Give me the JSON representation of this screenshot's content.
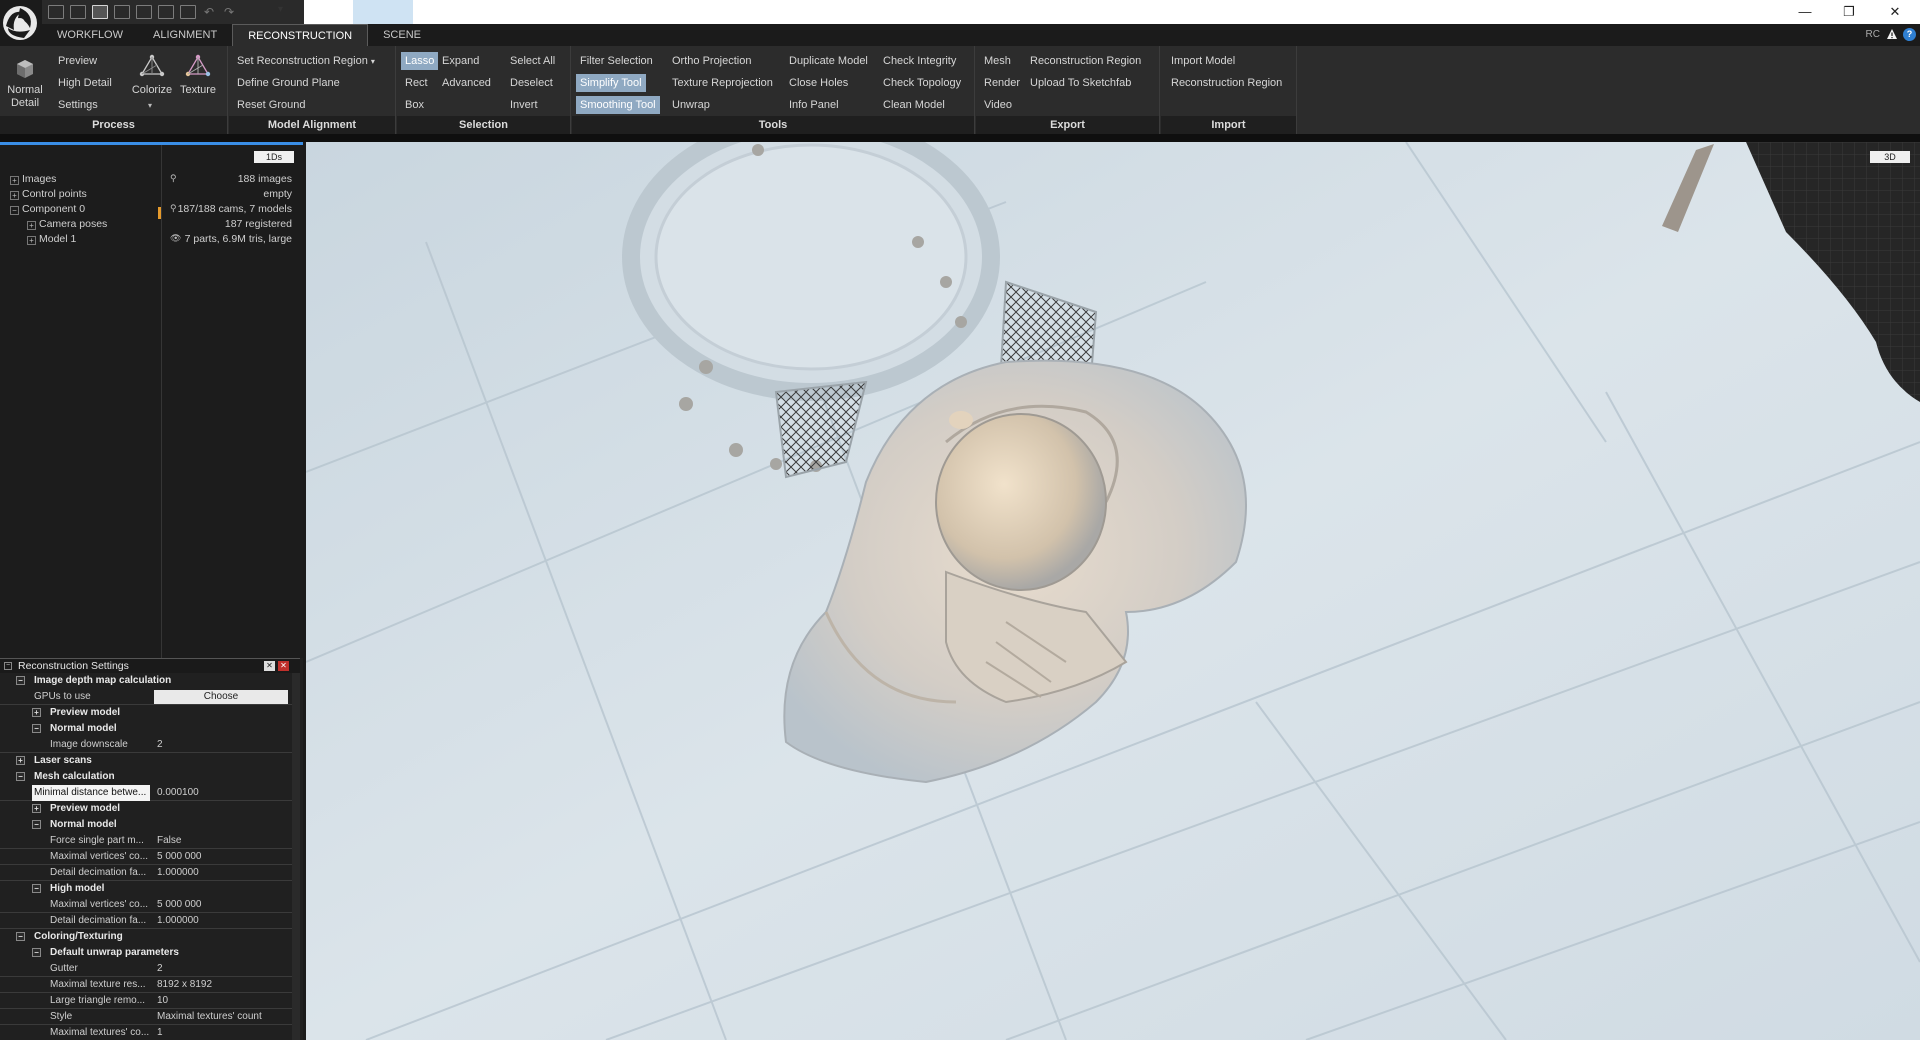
{
  "quick_access": {
    "dropdown_label": "▾",
    "undo": "↶",
    "redo": "↷"
  },
  "window_controls": {
    "minimize": "—",
    "restore": "❐",
    "close": "✕"
  },
  "tabs": [
    {
      "label": "WORKFLOW",
      "active": false
    },
    {
      "label": "ALIGNMENT",
      "active": false
    },
    {
      "label": "RECONSTRUCTION",
      "active": true
    },
    {
      "label": "SCENE",
      "active": false
    }
  ],
  "header_right": {
    "rc": "RC",
    "help": "?"
  },
  "ribbon": {
    "process": {
      "label": "Process",
      "normal_detail": "Normal Detail",
      "preview": "Preview",
      "high_detail": "High Detail",
      "settings": "Settings",
      "colorize": "Colorize",
      "texture": "Texture"
    },
    "model_alignment": {
      "label": "Model Alignment",
      "set_region": "Set Reconstruction Region",
      "define_ground": "Define Ground Plane",
      "reset_ground": "Reset Ground"
    },
    "selection": {
      "label": "Selection",
      "lasso": "Lasso",
      "expand": "Expand",
      "select_all": "Select All",
      "rect": "Rect",
      "advanced": "Advanced",
      "deselect": "Deselect",
      "box": "Box",
      "invert": "Invert"
    },
    "tools": {
      "label": "Tools",
      "filter_selection": "Filter Selection",
      "ortho_projection": "Ortho Projection",
      "duplicate_model": "Duplicate Model",
      "check_integrity": "Check Integrity",
      "simplify_tool": "Simplify Tool",
      "texture_reprojection": "Texture Reprojection",
      "close_holes": "Close Holes",
      "check_topology": "Check Topology",
      "smoothing_tool": "Smoothing Tool",
      "unwrap": "Unwrap",
      "info_panel": "Info Panel",
      "clean_model": "Clean Model"
    },
    "export": {
      "label": "Export",
      "mesh": "Mesh",
      "reconstruction_region": "Reconstruction Region",
      "render": "Render",
      "upload_sketchfab": "Upload To Sketchfab",
      "video": "Video"
    },
    "import": {
      "label": "Import",
      "import_model": "Import Model",
      "reconstruction_region": "Reconstruction Region"
    }
  },
  "tree": {
    "view_button": "1Ds",
    "items": [
      {
        "label": "Images",
        "expander": "+",
        "info": "188 images",
        "info_icon": "⚲"
      },
      {
        "label": "Control points",
        "expander": "+",
        "info": "empty",
        "info_icon": ""
      },
      {
        "label": "Component 0",
        "expander": "−",
        "info": "187/188 cams, 7 models",
        "info_icon": "⚲"
      },
      {
        "label": "Camera poses",
        "expander": "+",
        "info": "187 registered",
        "info_icon": ""
      },
      {
        "label": "Model 1",
        "expander": "+",
        "info": "7 parts, 6.9M tris, large",
        "info_icon": "👁"
      }
    ]
  },
  "settings": {
    "title": "Reconstruction Settings",
    "close_a": "✕",
    "close_b": "✕",
    "rows": [
      {
        "type": "section",
        "level": 1,
        "label": "Image depth map calculation",
        "exp": "−"
      },
      {
        "type": "choose",
        "level": 1,
        "label": "GPUs to use",
        "value": "Choose"
      },
      {
        "type": "section",
        "level": 2,
        "label": "Preview model",
        "exp": "+"
      },
      {
        "type": "section",
        "level": 2,
        "label": "Normal model",
        "exp": "−"
      },
      {
        "type": "kv",
        "level": 2,
        "label": "Image downscale",
        "value": "2"
      },
      {
        "type": "section",
        "level": 1,
        "label": "Laser scans",
        "exp": "+"
      },
      {
        "type": "section",
        "level": 1,
        "label": "Mesh calculation",
        "exp": "−"
      },
      {
        "type": "kv",
        "level": 1,
        "label": "Minimal distance betwe...",
        "value": "0.000100",
        "selected": true
      },
      {
        "type": "section",
        "level": 2,
        "label": "Preview model",
        "exp": "+"
      },
      {
        "type": "section",
        "level": 2,
        "label": "Normal model",
        "exp": "−"
      },
      {
        "type": "kv",
        "level": 2,
        "label": "Force single part m...",
        "value": "False"
      },
      {
        "type": "kv",
        "level": 2,
        "label": "Maximal vertices' co...",
        "value": "5 000 000"
      },
      {
        "type": "kv",
        "level": 2,
        "label": "Detail decimation fa...",
        "value": "1.000000"
      },
      {
        "type": "section",
        "level": 2,
        "label": "High model",
        "exp": "−"
      },
      {
        "type": "kv",
        "level": 2,
        "label": "Maximal vertices' co...",
        "value": "5 000 000"
      },
      {
        "type": "kv",
        "level": 2,
        "label": "Detail decimation fa...",
        "value": "1.000000"
      },
      {
        "type": "section",
        "level": 1,
        "label": "Coloring/Texturing",
        "exp": "−"
      },
      {
        "type": "section",
        "level": 2,
        "label": "Default unwrap parameters",
        "exp": "−"
      },
      {
        "type": "kv",
        "level": 2,
        "label": "Gutter",
        "value": "2"
      },
      {
        "type": "kv",
        "level": 2,
        "label": "Maximal texture res...",
        "value": "8192 x 8192"
      },
      {
        "type": "kv",
        "level": 2,
        "label": "Large triangle remo...",
        "value": "10"
      },
      {
        "type": "kv",
        "level": 2,
        "label": "Style",
        "value": "Maximal textures' count"
      },
      {
        "type": "kv",
        "level": 2,
        "label": "Maximal textures' co...",
        "value": "1"
      }
    ]
  },
  "viewport": {
    "view_button": "3D"
  },
  "colors": {
    "accent": "#3a8ee6",
    "highlight": "#8fa9c2",
    "marker": "#e59a2c"
  }
}
